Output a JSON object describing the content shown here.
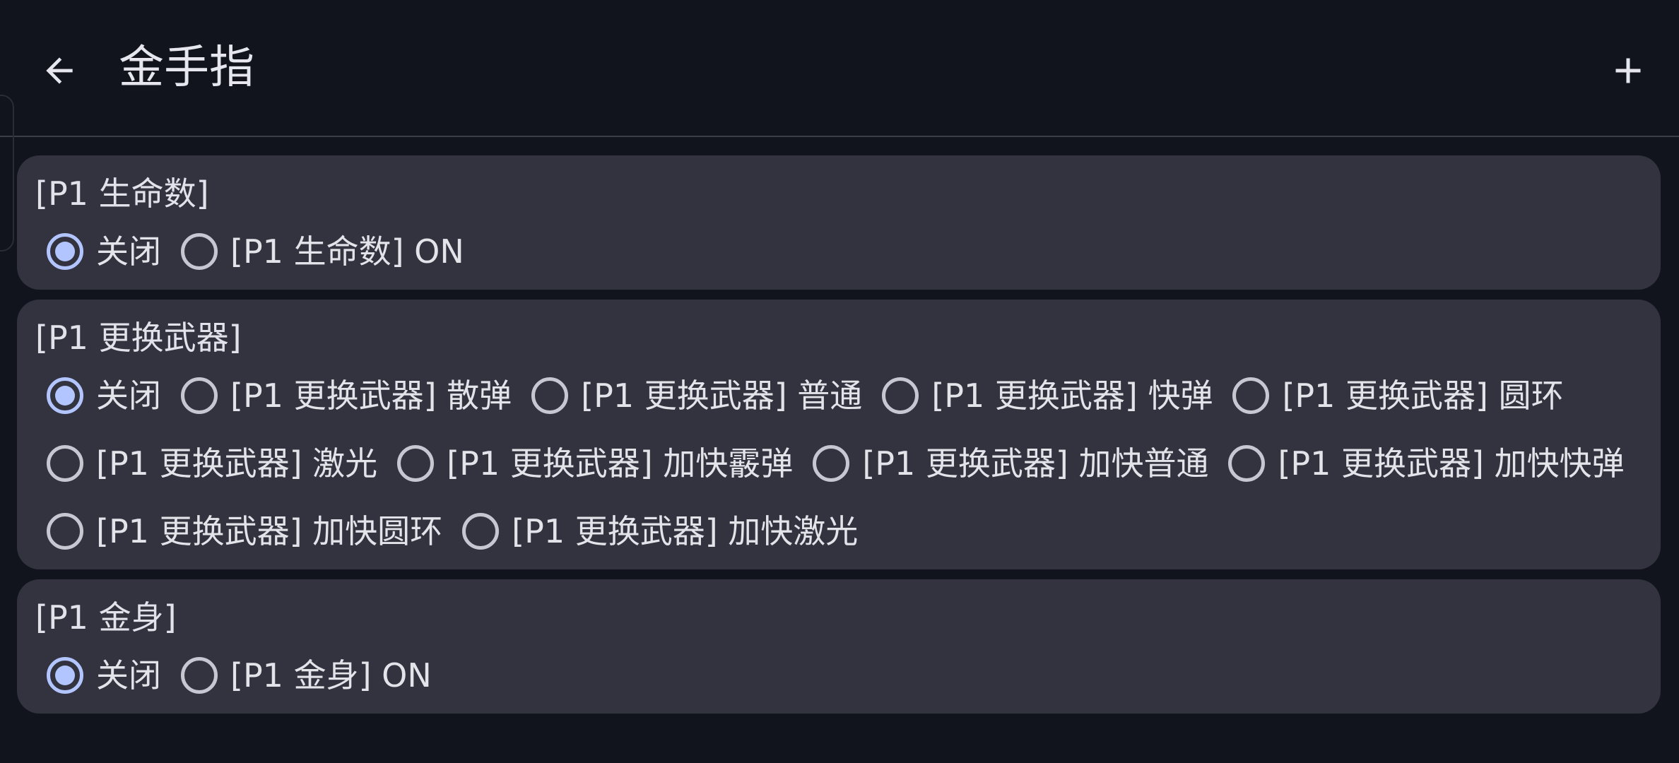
{
  "header": {
    "title": "金手指"
  },
  "cheats": [
    {
      "title": "[P1 生命数]",
      "options": [
        {
          "label": "关闭",
          "selected": true
        },
        {
          "label": "[P1 生命数] ON",
          "selected": false
        }
      ]
    },
    {
      "title": "[P1 更换武器]",
      "options": [
        {
          "label": "关闭",
          "selected": true
        },
        {
          "label": "[P1 更换武器] 散弹",
          "selected": false
        },
        {
          "label": "[P1 更换武器] 普通",
          "selected": false
        },
        {
          "label": "[P1 更换武器] 快弹",
          "selected": false
        },
        {
          "label": "[P1 更换武器] 圆环",
          "selected": false
        },
        {
          "label": "[P1 更换武器] 激光",
          "selected": false
        },
        {
          "label": "[P1 更换武器] 加快霰弹",
          "selected": false
        },
        {
          "label": "[P1 更换武器] 加快普通",
          "selected": false
        },
        {
          "label": "[P1 更换武器] 加快快弹",
          "selected": false
        },
        {
          "label": "[P1 更换武器] 加快圆环",
          "selected": false
        },
        {
          "label": "[P1 更换武器] 加快激光",
          "selected": false
        }
      ]
    },
    {
      "title": "[P1 金身]",
      "options": [
        {
          "label": "关闭",
          "selected": true
        },
        {
          "label": "[P1 金身] ON",
          "selected": false
        }
      ]
    }
  ],
  "colors": {
    "background": "#11141c",
    "card": "#32333f",
    "accent": "#b3c5ff"
  },
  "icons": {
    "back": "arrow-back-icon",
    "add": "plus-icon"
  }
}
